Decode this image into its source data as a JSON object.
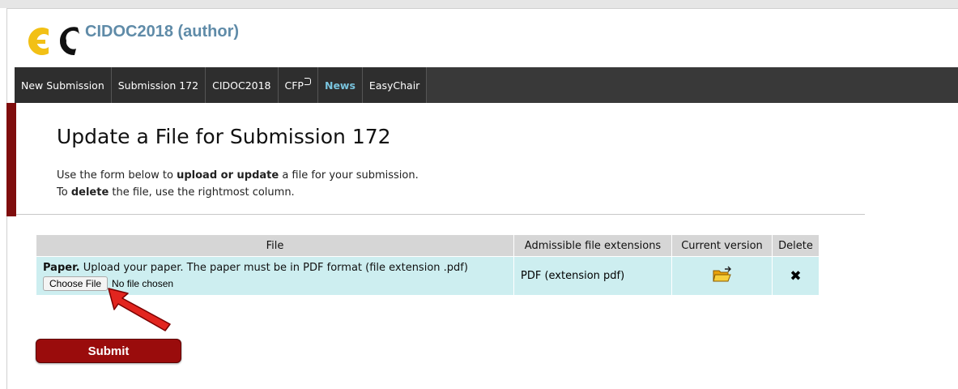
{
  "app": {
    "title": "CIDOC2018 (author)",
    "logo_icon": "easychair-logo"
  },
  "navbar": {
    "items": [
      {
        "label": "New Submission"
      },
      {
        "label": "Submission 172"
      },
      {
        "label": "CIDOC2018"
      },
      {
        "label": "CFP"
      },
      {
        "label": "News"
      },
      {
        "label": "EasyChair"
      }
    ]
  },
  "page": {
    "title": "Update a File for Submission 172",
    "intro_line1_a": "Use the form below to ",
    "intro_line1_b": "upload or update",
    "intro_line1_c": " a file for your submission.",
    "intro_line2_a": "To ",
    "intro_line2_b": "delete",
    "intro_line2_c": " the file, use the rightmost column."
  },
  "table": {
    "headers": [
      "File",
      "Admissible file extensions",
      "Current version",
      "Delete"
    ],
    "row": {
      "file_label": "Paper.",
      "file_desc": " Upload your paper. The paper must be in PDF format (file extension .pdf)",
      "choose_button": "Choose File",
      "no_file": "No file chosen",
      "extension": "PDF (extension pdf)",
      "current_version_icon": "open-folder-icon",
      "delete_symbol": "✖"
    }
  },
  "submit": {
    "label": "Submit"
  },
  "colors": {
    "accent": "#9a0c0c",
    "nav_bg": "#393939",
    "link": "#79c3dd",
    "row_bg": "#cdeef0"
  }
}
